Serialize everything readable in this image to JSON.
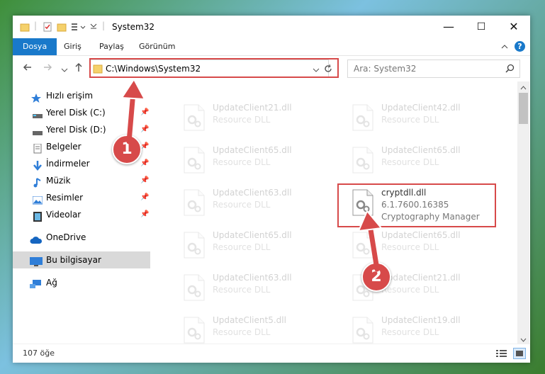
{
  "titlebar": {
    "title": "System32",
    "minimize": "—",
    "maximize": "☐",
    "close": "✕"
  },
  "ribbon": {
    "tabs": [
      "Dosya",
      "Giriş",
      "Paylaş",
      "Görünüm"
    ],
    "help": "?"
  },
  "address": {
    "path": "C:\\Windows\\System32",
    "search_placeholder": "Ara: System32"
  },
  "sidebar": {
    "items": [
      {
        "label": "Hızlı erişim",
        "icon": "star-icon"
      },
      {
        "label": "Yerel Disk (C:)",
        "icon": "drive-icon"
      },
      {
        "label": "Yerel Disk (D:)",
        "icon": "drive-icon"
      },
      {
        "label": "Belgeler",
        "icon": "document-icon"
      },
      {
        "label": "İndirmeler",
        "icon": "download-icon"
      },
      {
        "label": "Müzik",
        "icon": "music-icon"
      },
      {
        "label": "Resimler",
        "icon": "pictures-icon"
      },
      {
        "label": "Videolar",
        "icon": "video-icon"
      },
      {
        "label": "OneDrive",
        "icon": "cloud-icon"
      },
      {
        "label": "Bu bilgisayar",
        "icon": "computer-icon"
      },
      {
        "label": "Ağ",
        "icon": "network-icon"
      }
    ]
  },
  "files": [
    {
      "name": "UpdateClient21.dll",
      "sub": "Resource DLL"
    },
    {
      "name": "UpdateClient42.dll",
      "sub": "Resource DLL"
    },
    {
      "name": "UpdateClient65.dll",
      "sub": "Resource DLL"
    },
    {
      "name": "UpdateClient65.dll",
      "sub": "Resource DLL"
    },
    {
      "name": "UpdateClient63.dll",
      "sub": "Resource DLL"
    },
    {
      "name": "cryptdll.dll",
      "version": "6.1.7600.16385",
      "sub": "Cryptography Manager"
    },
    {
      "name": "UpdateClient65.dll",
      "sub": "Resource DLL"
    },
    {
      "name": "UpdateClient65.dll",
      "sub": "Resource DLL"
    },
    {
      "name": "UpdateClient63.dll",
      "sub": "Resource DLL"
    },
    {
      "name": "UpdateClient21.dll",
      "sub": "Resource DLL"
    },
    {
      "name": "UpdateClient5.dll",
      "sub": "Resource DLL"
    },
    {
      "name": "UpdateClient19.dll",
      "sub": "Resource DLL"
    }
  ],
  "status": {
    "count": "107 öğe"
  },
  "annotations": {
    "step1": "1",
    "step2": "2"
  },
  "colors": {
    "accent": "#1979ca",
    "highlight": "#d74a4a"
  }
}
